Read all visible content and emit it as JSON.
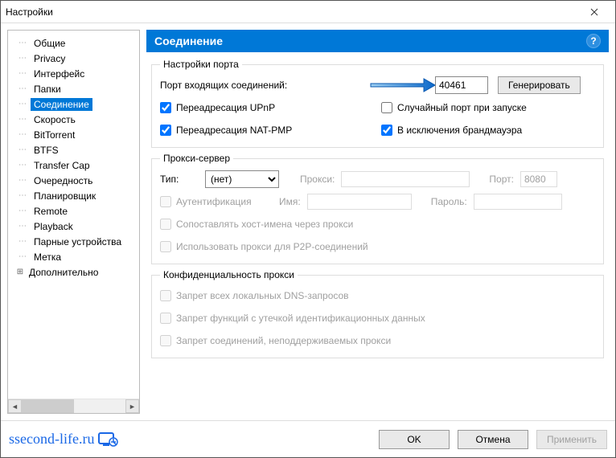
{
  "window": {
    "title": "Настройки"
  },
  "tree": {
    "items": [
      {
        "label": "Общие"
      },
      {
        "label": "Privacy"
      },
      {
        "label": "Интерфейс"
      },
      {
        "label": "Папки"
      },
      {
        "label": "Соединение",
        "selected": true
      },
      {
        "label": "Скорость"
      },
      {
        "label": "BitTorrent"
      },
      {
        "label": "BTFS"
      },
      {
        "label": "Transfer Cap"
      },
      {
        "label": "Очередность"
      },
      {
        "label": "Планировщик"
      },
      {
        "label": "Remote"
      },
      {
        "label": "Playback"
      },
      {
        "label": "Парные устройства"
      },
      {
        "label": "Метка"
      }
    ],
    "advanced_label": "Дополнительно"
  },
  "panel": {
    "title": "Соединение"
  },
  "port": {
    "legend": "Настройки порта",
    "incoming_label": "Порт входящих соединений:",
    "value": "40461",
    "generate_btn": "Генерировать",
    "upnp": "Переадресация UPnP",
    "natpmp": "Переадресация NAT-PMP",
    "random": "Случайный порт при запуске",
    "firewall": "В исключения брандмауэра"
  },
  "proxy": {
    "legend": "Прокси-сервер",
    "type_label": "Тип:",
    "type_value": "(нет)",
    "proxy_label": "Прокси:",
    "port_label": "Порт:",
    "port_value": "8080",
    "auth": "Аутентификация",
    "name_label": "Имя:",
    "pass_label": "Пароль:",
    "hostnames": "Сопоставлять хост-имена через прокси",
    "p2p": "Использовать прокси для P2P-соединений"
  },
  "privacy": {
    "legend": "Конфиденциальность прокси",
    "dns": "Запрет всех локальных DNS-запросов",
    "leak": "Запрет функций с утечкой идентификационных данных",
    "unsupported": "Запрет соединений, неподдерживаемых прокси"
  },
  "footer": {
    "watermark": "ssecond-life.ru",
    "ok": "OK",
    "cancel": "Отмена",
    "apply": "Применить"
  }
}
